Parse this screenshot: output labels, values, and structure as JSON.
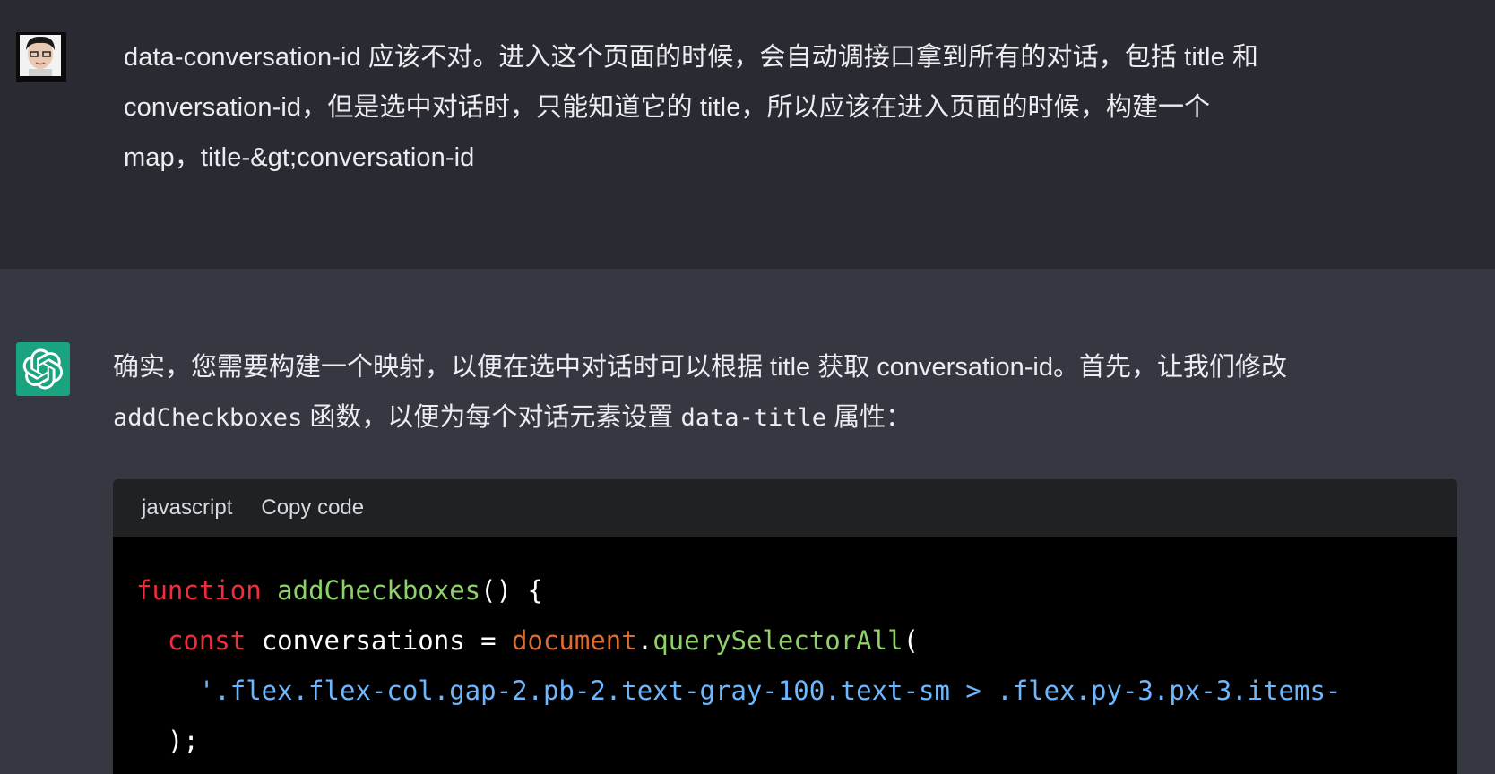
{
  "user_message": {
    "lines": [
      "data-conversation-id 应该不对。进入这个页面的时候，会自动调接口拿到所有的对话，包括 title 和",
      "conversation-id，但是选中对话时，只能知道它的 title，所以应该在进入页面的时候，构建一个",
      "map，title-&gt;conversation-id"
    ]
  },
  "assistant_message": {
    "line1": "确实，您需要构建一个映射，以便在选中对话时可以根据 title 获取 conversation-id。首先，让我们修改",
    "line2_code1": "addCheckboxes",
    "line2_text1": " 函数，以便为每个对话元素设置 ",
    "line2_code2": "data-title",
    "line2_text2": " 属性："
  },
  "code_block": {
    "language": "javascript",
    "copy_label": "Copy code",
    "line1": {
      "kw": "function",
      "sp": " ",
      "fn": "addCheckboxes",
      "rest": "() {"
    },
    "line2": {
      "indent": "  ",
      "kw": "const",
      "mid": " conversations = ",
      "obj": "document",
      "dot": ".",
      "fn": "querySelectorAll",
      "rest": "("
    },
    "line3": {
      "indent": "    ",
      "str": "'.flex.flex-col.gap-2.pb-2.text-gray-100.text-sm > .flex.py-3.px-3.items-"
    },
    "line4": {
      "indent": "  ",
      "rest": ");"
    }
  },
  "colors": {
    "user_bg": "#2a2b32",
    "assistant_bg": "#353741",
    "bot_avatar": "#19a37f",
    "keyword": "#f22c3d",
    "function": "#8fd06c",
    "object": "#df6c2f",
    "string": "#6db7ff"
  },
  "icons": {
    "user_avatar": "user-avatar-photo",
    "bot_avatar": "openai-logo-icon"
  }
}
